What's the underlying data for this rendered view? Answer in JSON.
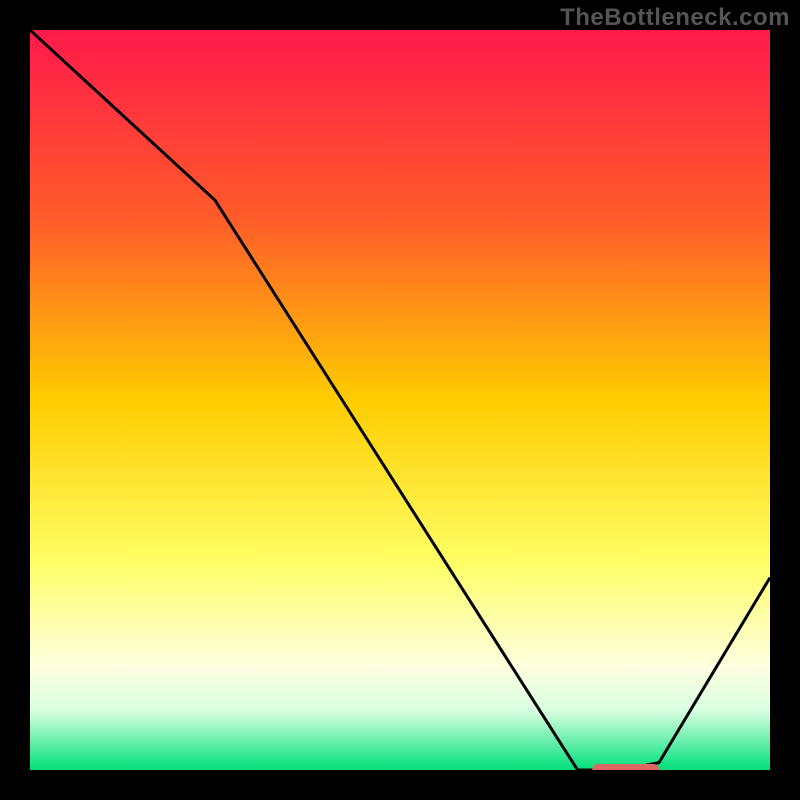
{
  "watermark": "TheBottleneck.com",
  "chart_data": {
    "type": "line",
    "title": "",
    "xlabel": "",
    "ylabel": "",
    "xlim": [
      0,
      100
    ],
    "ylim": [
      0,
      100
    ],
    "x": [
      0,
      25,
      74,
      80,
      85,
      100
    ],
    "values": [
      100,
      77,
      0,
      0,
      1,
      26
    ],
    "gradient_stops": [
      {
        "offset": 0.0,
        "color": "#ff1a4b"
      },
      {
        "offset": 0.25,
        "color": "#ff5a2a"
      },
      {
        "offset": 0.5,
        "color": "#ffcc00"
      },
      {
        "offset": 0.72,
        "color": "#ffff66"
      },
      {
        "offset": 0.86,
        "color": "#fdffe0"
      },
      {
        "offset": 0.92,
        "color": "#d8ffe0"
      },
      {
        "offset": 1.0,
        "color": "#00e07a"
      }
    ],
    "marker": {
      "x_start": 76,
      "x_end": 85,
      "y": 0,
      "color": "#e06666"
    },
    "line_color": "#000000",
    "background_frame_color": "#000000"
  }
}
